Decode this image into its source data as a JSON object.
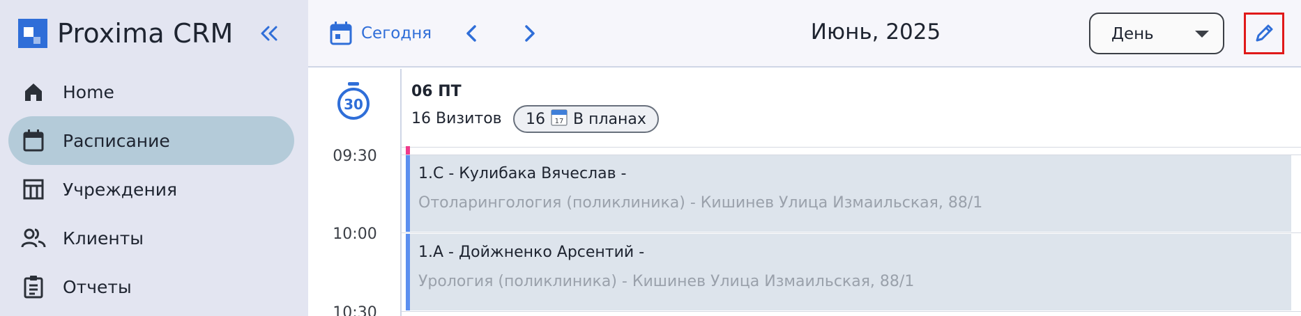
{
  "app": {
    "brand_name": "Proxima CRM",
    "accent_color": "#2f6ed8"
  },
  "sidebar": {
    "collapse_icon": "double-chevron-left-icon",
    "items": [
      {
        "label": "Home",
        "icon": "home-icon",
        "active": false
      },
      {
        "label": "Расписание",
        "icon": "calendar-icon",
        "active": true
      },
      {
        "label": "Учреждения",
        "icon": "table-icon",
        "active": false
      },
      {
        "label": "Клиенты",
        "icon": "people-icon",
        "active": false
      },
      {
        "label": "Отчеты",
        "icon": "clipboard-icon",
        "active": false
      }
    ]
  },
  "toolbar": {
    "today_label": "Сегодня",
    "prev_icon": "chevron-left-icon",
    "next_icon": "chevron-right-icon",
    "month_title": "Июнь, 2025",
    "view_select": {
      "value": "День"
    },
    "edit_icon": "pencil-icon"
  },
  "timeline": {
    "interval_badge": "30",
    "times": [
      "09:30",
      "10:00",
      "10:30"
    ]
  },
  "day": {
    "title": "06 ПТ",
    "visits_label": "16 Визитов",
    "planned_badge": {
      "count": "16",
      "icon": "calendar-emoji",
      "label": "В планах"
    }
  },
  "events": [
    {
      "title": "1.С - Кулибака Вячеслав -",
      "subtitle": "Отоларингология (поликлиника) - Кишинев Улица Измаильская, 88/1"
    },
    {
      "title": "1.А - Дойжненко Арсентий -",
      "subtitle": "Урология (поликлиника) - Кишинев Улица Измаильская, 88/1"
    }
  ]
}
